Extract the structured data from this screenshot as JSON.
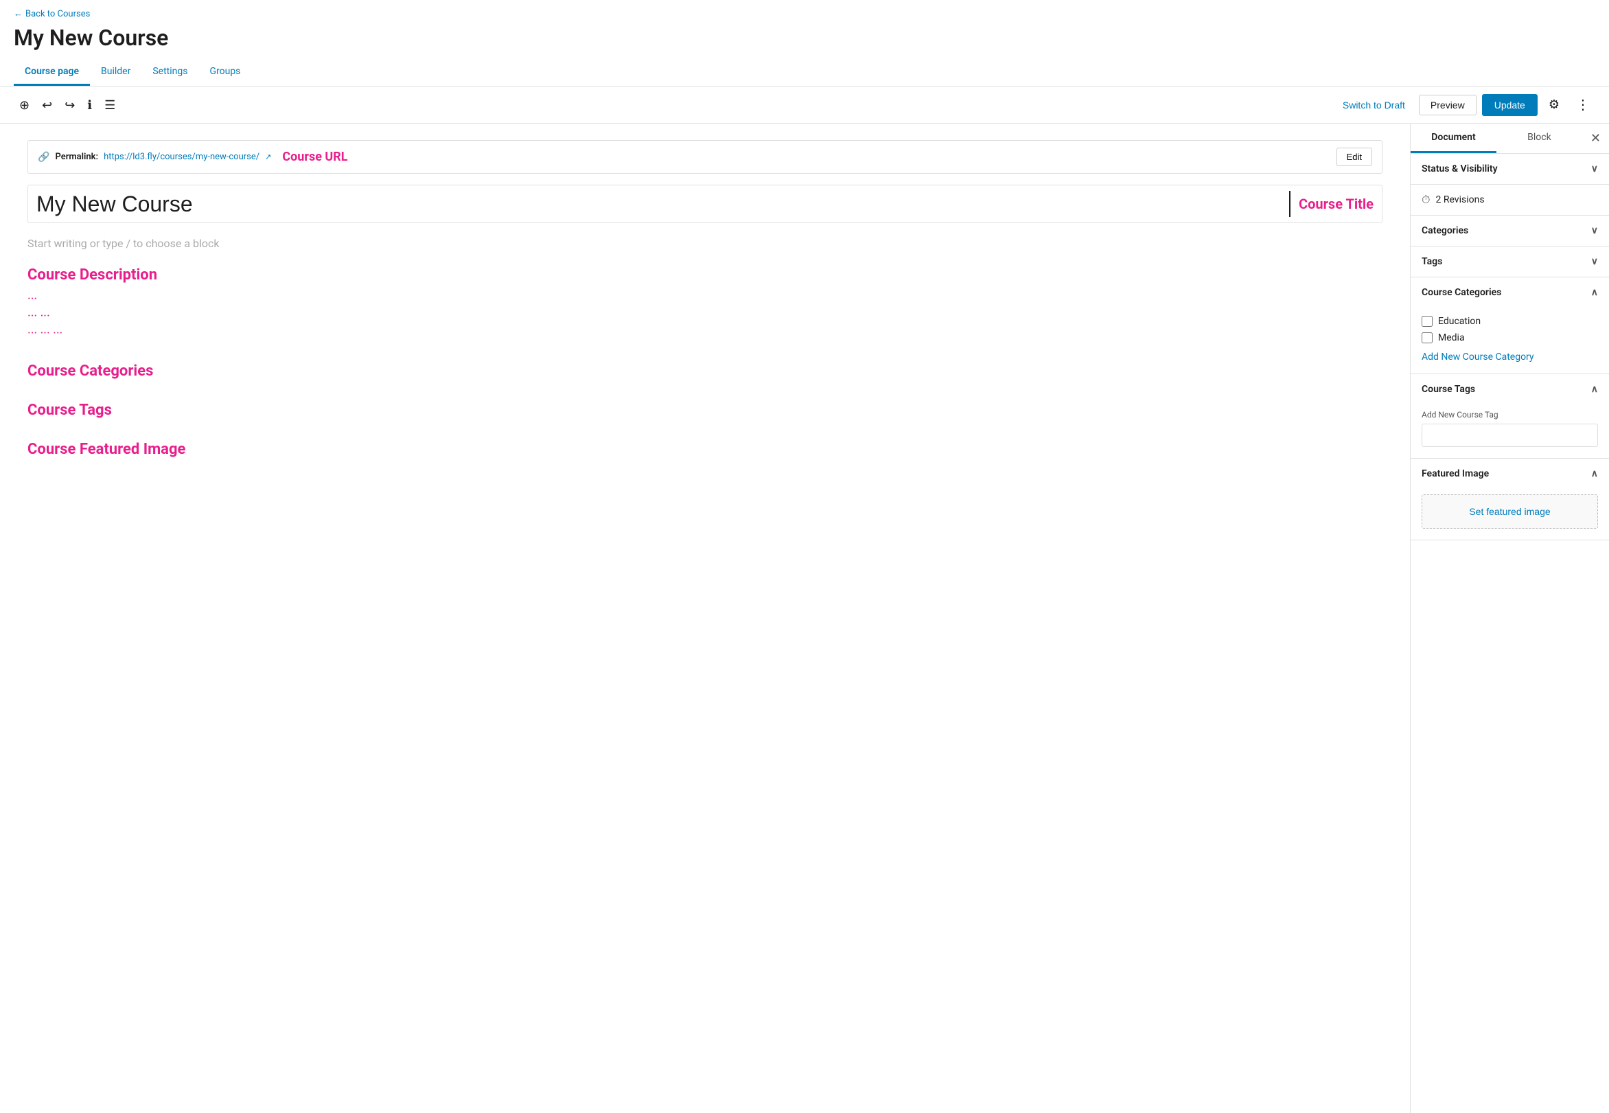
{
  "header": {
    "back_link": "Back to Courses",
    "page_title": "My New Course",
    "tabs": [
      {
        "id": "course-page",
        "label": "Course page",
        "active": true
      },
      {
        "id": "builder",
        "label": "Builder",
        "active": false
      },
      {
        "id": "settings",
        "label": "Settings",
        "active": false
      },
      {
        "id": "groups",
        "label": "Groups",
        "active": false
      }
    ]
  },
  "toolbar": {
    "switch_draft_label": "Switch to Draft",
    "preview_label": "Preview",
    "update_label": "Update"
  },
  "editor": {
    "permalink_label": "Permalink:",
    "permalink_url": "https://ld3.fly/courses/my-new-course/",
    "edit_label": "Edit",
    "annotation_url": "Course URL",
    "course_title": "My New Course",
    "annotation_title": "Course Title",
    "block_placeholder": "Start writing or type / to choose a block",
    "annotation_desc": "Course Description",
    "annotation_categories": "Course Categories",
    "annotation_tags": "Course Tags",
    "annotation_featured": "Course Featured Image",
    "dot_lines": [
      "···",
      "··· ···",
      "··· ··· ···"
    ]
  },
  "sidebar": {
    "document_tab": "Document",
    "block_tab": "Block",
    "sections": {
      "status_visibility": {
        "label": "Status & Visibility",
        "expanded": false
      },
      "revisions": {
        "label": "2 Revisions",
        "icon": "⏱"
      },
      "categories": {
        "label": "Categories",
        "expanded": false
      },
      "tags": {
        "label": "Tags",
        "expanded": false
      },
      "course_categories": {
        "label": "Course Categories",
        "expanded": true,
        "items": [
          {
            "id": "education",
            "label": "Education",
            "checked": false
          },
          {
            "id": "media",
            "label": "Media",
            "checked": false
          }
        ],
        "add_link": "Add New Course Category"
      },
      "course_tags": {
        "label": "Course Tags",
        "expanded": true,
        "input_label": "Add New Course Tag",
        "input_placeholder": ""
      },
      "featured_image": {
        "label": "Featured Image",
        "expanded": true,
        "set_label": "Set featured image"
      }
    }
  }
}
